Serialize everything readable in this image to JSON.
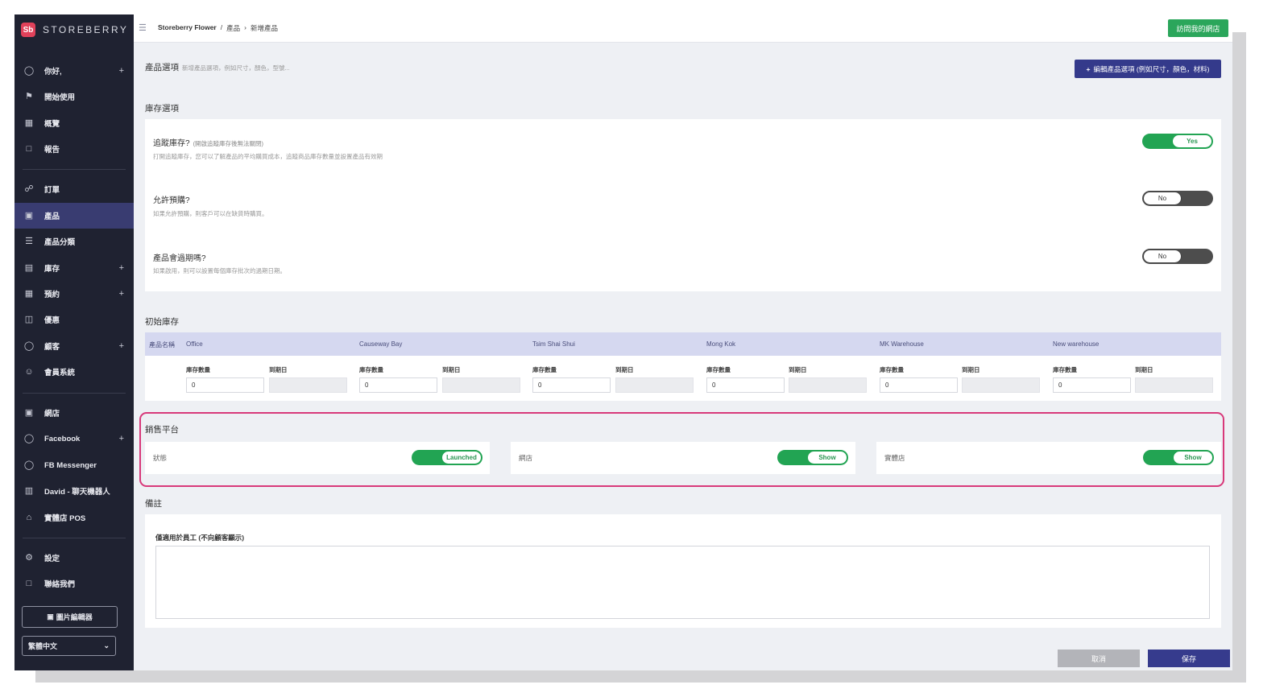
{
  "brand": {
    "name": "STOREBERRY",
    "logo_text": "Sb"
  },
  "sidebar": {
    "items": [
      {
        "label": "你好,",
        "icon": "user-icon",
        "plus": true
      },
      {
        "label": "開始使用",
        "icon": "flag-icon",
        "plus": false
      },
      {
        "label": "概覽",
        "icon": "chart-icon",
        "plus": false
      },
      {
        "label": "報告",
        "icon": "document-icon",
        "plus": false
      },
      {
        "label": "訂單",
        "icon": "cart-icon",
        "plus": false
      },
      {
        "label": "產品",
        "icon": "bag-icon",
        "plus": false,
        "active": true
      },
      {
        "label": "產品分類",
        "icon": "list-icon",
        "plus": false
      },
      {
        "label": "庫存",
        "icon": "box-icon",
        "plus": true
      },
      {
        "label": "預約",
        "icon": "calendar-icon",
        "plus": true
      },
      {
        "label": "優惠",
        "icon": "ticket-icon",
        "plus": false
      },
      {
        "label": "顧客",
        "icon": "customer-icon",
        "plus": true
      },
      {
        "label": "會員系統",
        "icon": "members-icon",
        "plus": false
      },
      {
        "label": "網店",
        "icon": "store-icon",
        "plus": false
      },
      {
        "label": "Facebook",
        "icon": "facebook-icon",
        "plus": true
      },
      {
        "label": "FB Messenger",
        "icon": "messenger-icon",
        "plus": false
      },
      {
        "label": "David - 聊天機器人",
        "icon": "robot-icon",
        "plus": false
      },
      {
        "label": "實體店 POS",
        "icon": "home-icon",
        "plus": false
      },
      {
        "label": "設定",
        "icon": "gear-icon",
        "plus": false
      },
      {
        "label": "聯絡我們",
        "icon": "chat-icon",
        "plus": false
      }
    ],
    "image_editor_label": "圖片編輯器",
    "language": "繁體中文"
  },
  "topbar": {
    "breadcrumb": [
      "Storeberry Flower",
      "產品",
      "新增產品"
    ],
    "visit_button": "訪問我的網店"
  },
  "product_options": {
    "title": "產品選項",
    "subtitle": "新增產品選項，例如尺寸，顏色，型號...",
    "edit_button": "編輯產品選項 (例如尺寸，顏色，材料)"
  },
  "stock_options": {
    "title": "庫存選項",
    "items": [
      {
        "title": "追蹤庫存?",
        "hint": "(開啟追蹤庫存後無法關閉)",
        "desc": "打開追蹤庫存，您可以了解產品的平均購買成本，追蹤商品庫存數量並設置產品有效期",
        "value": "Yes",
        "on": true
      },
      {
        "title": "允許預購?",
        "hint": "",
        "desc": "如果允許預購，則客戶可以在缺貨時購買。",
        "value": "No",
        "on": false
      },
      {
        "title": "產品會過期嗎?",
        "hint": "",
        "desc": "如果啟用，則可以設置每個庫存批次的過期日期。",
        "value": "No",
        "on": false
      }
    ]
  },
  "initial_stock": {
    "title": "初始庫存",
    "product_name_header": "產品名稱",
    "qty_label": "庫存數量",
    "expiry_label": "到期日",
    "locations": [
      {
        "name": "Office",
        "qty": "0"
      },
      {
        "name": "Causeway Bay",
        "qty": "0"
      },
      {
        "name": "Tsim Shai Shui",
        "qty": "0"
      },
      {
        "name": "Mong Kok",
        "qty": "0"
      },
      {
        "name": "MK Warehouse",
        "qty": "0"
      },
      {
        "name": "New warehouse",
        "qty": "0"
      }
    ]
  },
  "sales_platform": {
    "title": "銷售平台",
    "items": [
      {
        "label": "狀態",
        "value": "Launched"
      },
      {
        "label": "網店",
        "value": "Show"
      },
      {
        "label": "實體店",
        "value": "Show"
      }
    ]
  },
  "notes": {
    "title": "備註",
    "label": "僅適用於員工 (不向顧客顯示)"
  },
  "footer": {
    "cancel": "取消",
    "save": "保存"
  },
  "colors": {
    "sidebar": "#1f2231",
    "accent": "#363b8d",
    "toggle_on": "#22a453",
    "highlight": "#d8397a"
  }
}
